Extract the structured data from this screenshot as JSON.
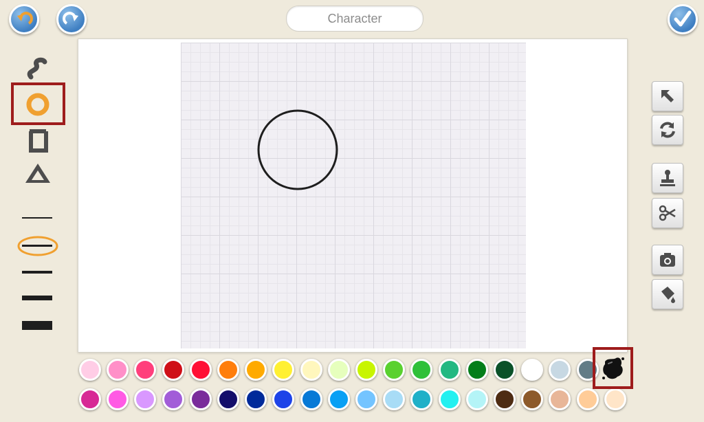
{
  "header": {
    "title": "Character"
  },
  "icons": {
    "undo": "undo-icon",
    "redo": "redo-icon",
    "done": "checkmark-icon"
  },
  "tools": [
    "wave-pen-tool",
    "circle-tool",
    "rectangle-tool",
    "triangle-tool"
  ],
  "selected_tool": "circle-tool",
  "line_widths": [
    "thin",
    "medium-thin",
    "medium",
    "thick",
    "extra-thick"
  ],
  "selected_line_width": "medium-thin",
  "right_tools": [
    "arrow-select-icon",
    "rotate-icon",
    "stamp-icon",
    "scissors-icon",
    "camera-icon",
    "paint-bucket-icon"
  ],
  "colors": {
    "accent_selection": "#9e1c1c",
    "tool_orange": "#f0a030",
    "row1": [
      "#ffcde6",
      "#ff8fc8",
      "#ff3f7c",
      "#cf0f17",
      "#ff1035",
      "#ff7e0c",
      "#ffaa00",
      "#fff033",
      "#fff7bd",
      "#e6ffbd",
      "#c8f500",
      "#5ad12f",
      "#2fc03a",
      "#23b882",
      "#037e1a",
      "#0a5129",
      "#ffffff",
      "#c7d8e3",
      "#627c86"
    ],
    "row2": [
      "#d72995",
      "#ff5ae4",
      "#d998ff",
      "#a25dd8",
      "#7a2c9b",
      "#130e6b",
      "#002a9a",
      "#1d43e8",
      "#0779d6",
      "#09a0f4",
      "#74c4ff",
      "#a8dcf6",
      "#20b0c8",
      "#23f0f0",
      "#b4f4f7",
      "#4e2c13",
      "#8d5a2b",
      "#e8b698",
      "#ffcc98",
      "#ffe5c8"
    ],
    "selected": "black-ink"
  },
  "canvas": {
    "shapes": [
      {
        "type": "circle",
        "stroke": "#1e1e1e"
      }
    ]
  }
}
